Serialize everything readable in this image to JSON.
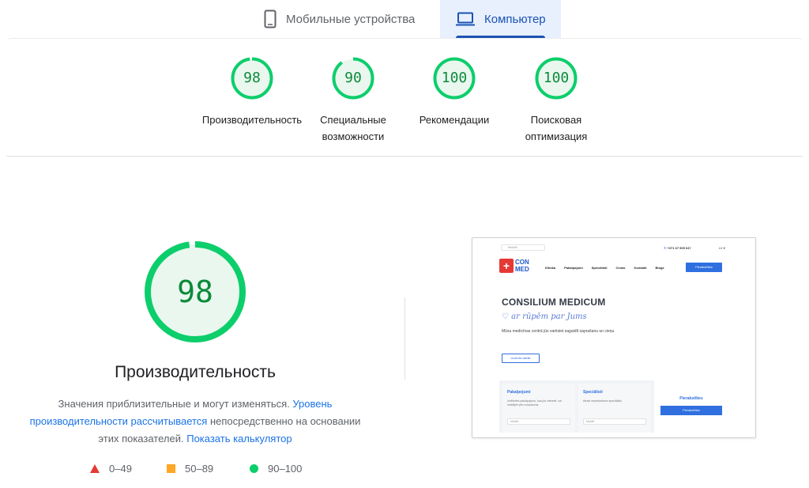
{
  "tabs": {
    "mobile_label": "Мобильные устройства",
    "desktop_label": "Компьютер",
    "active": "desktop",
    "accent_color": "#1a53b3"
  },
  "scores": [
    {
      "value": 98,
      "label": "Производительность"
    },
    {
      "value": 90,
      "label": "Специальные возможности"
    },
    {
      "value": 100,
      "label": "Рекомендации"
    },
    {
      "value": 100,
      "label": "Поисковая оптимизация"
    }
  ],
  "performance": {
    "score": 98,
    "title": "Производительность",
    "desc_part1": "Значения приблизительные и могут изменяться.",
    "desc_link1": "Уровень производительности рассчитывается",
    "desc_part2": "непосредственно на основании этих показателей.",
    "desc_link2": "Показать калькулятор"
  },
  "legend": {
    "fail": "0–49",
    "average": "50–89",
    "pass": "90–100",
    "fail_color": "#e53935",
    "average_color": "#ffa726",
    "pass_color": "#0cce6b"
  },
  "screenshot": {
    "search_placeholder": "Meklēt",
    "phone": "+371 67 505 047",
    "lang": "LV ▾",
    "logo_line1": "CON",
    "logo_line2": "MED",
    "menu": [
      "Klīnika",
      "Pakalpojumi",
      "Speciālisti",
      "Cenas",
      "Kontakti",
      "Blogs"
    ],
    "nav_button": "Pierakstīties",
    "hero_title": "CONSILIUM MEDICUM",
    "hero_script": "♡ ar rūpēm par Jums",
    "hero_text": "Mūsu medicīnas centrā jūs varēsiet sagaidīt saprašanu un cieņu",
    "hero_button": "Uzzināt vairāk",
    "card1_title": "Pakalpojumi",
    "card1_text": "Izvēlieties pakalpojumu, kas jūs interesē, vai meklējiet pēc nosaukuma",
    "card1_input": "Meklēt",
    "card2_title": "Speciālisti",
    "card2_text": "Atrast nepieciešamo speciālistu",
    "card2_input": "Meklēt",
    "card3_title": "Pierakstīties",
    "card3_button": "Pierakstīties"
  }
}
